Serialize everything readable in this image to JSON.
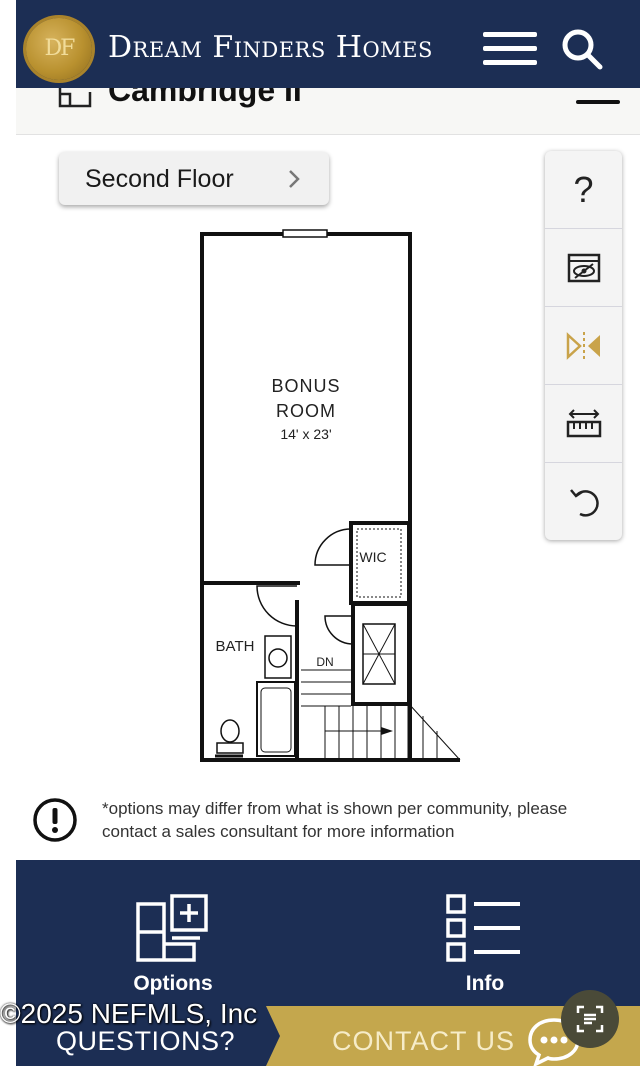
{
  "header": {
    "logo_text": "DF",
    "brand": "Dream Finders Homes",
    "menu_icon": "hamburger-menu-icon",
    "search_icon": "search-icon"
  },
  "subheader": {
    "plan_name": "Cambridge II"
  },
  "floor_selector": {
    "label": "Second Floor"
  },
  "tools": {
    "help_label": "?",
    "items": [
      "help-icon",
      "view-toggle-icon",
      "mirror-icon",
      "measure-icon",
      "reset-icon"
    ],
    "accent_color": "#c9a34a"
  },
  "floorplan": {
    "bonus_room_name_1": "BONUS",
    "bonus_room_name_2": "ROOM",
    "bonus_room_size": "14' x 23'",
    "wic_label": "WIC",
    "bath_label": "BATH",
    "stairs_label": "DN"
  },
  "disclaimer": {
    "text": "*options may differ from what is shown per community, please contact a sales consultant for more information"
  },
  "bottom_nav": {
    "options_label": "Options",
    "info_label": "Info"
  },
  "contact": {
    "questions_label": "QUESTIONS?",
    "contact_label": "CONTACT US"
  },
  "watermark": {
    "copyright": "©2025 NEFMLS, Inc"
  },
  "colors": {
    "navy": "#1c2e54",
    "gold": "#c4a74d"
  }
}
